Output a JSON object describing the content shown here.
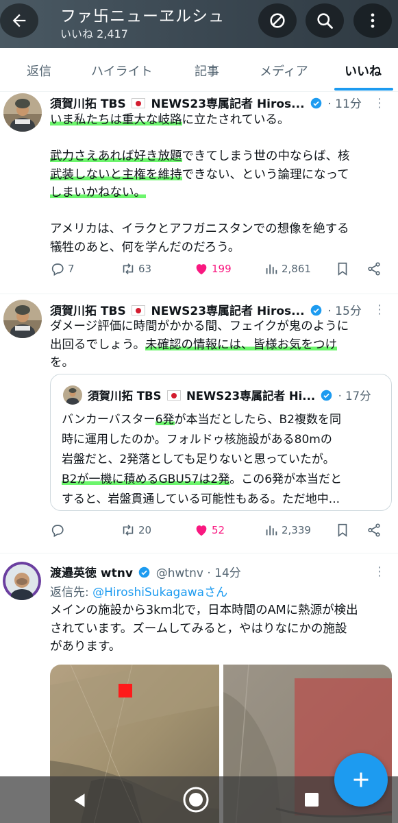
{
  "header": {
    "title": "ファ卐ニューヱルシュ",
    "likes": "いいね 2,417"
  },
  "tabs": [
    "返信",
    "ハイライト",
    "記事",
    "メディア",
    "いいね"
  ],
  "posts": [
    {
      "name": "須賀川拓 TBS",
      "name_suffix": "NEWS23専属記者 Hiros...",
      "time": "· 11分",
      "lines": [
        [
          "",
          "いま私たちは重大な岐路",
          "に立たされている。"
        ],
        [
          "",
          "",
          ""
        ],
        [
          "",
          "武力さえあれば好き放題",
          "できてしまう世の中ならば、核"
        ],
        [
          "",
          "武装しないと主権を維持",
          "できない、という論理になって"
        ],
        [
          "",
          "しまいかねない。",
          ""
        ],
        [
          "",
          "",
          ""
        ],
        [
          "アメリカは、イラクとアフガニスタンでの想像を絶する",
          "",
          ""
        ],
        [
          "犠牲のあと、何を学んだのだろう。",
          "",
          ""
        ]
      ],
      "reply": "7",
      "repost": "63",
      "like": "199",
      "views": "2,861"
    },
    {
      "name": "須賀川拓 TBS",
      "name_suffix": "NEWS23専属記者 Hiros...",
      "time": "· 15分",
      "lines": [
        [
          "ダメージ評価に時間がかかる間、フェイクが鬼のように",
          "",
          ""
        ],
        [
          "出回るでしょう。",
          "未確認の情報には、皆様お気をつけ",
          ""
        ],
        [
          "を。",
          "",
          ""
        ]
      ],
      "quote": {
        "name": "須賀川拓 TBS",
        "name_suffix": "NEWS23専属記者 Hi...",
        "time": "· 17分",
        "lines": [
          [
            "バンカーバスター",
            "6発",
            "が本当だとしたら、B2複数を同"
          ],
          [
            "時に運用したのか。フォルドゥ核施設がある80mの",
            "",
            ""
          ],
          [
            "岩盤だと、2発落としても足りないと思っていたが。",
            "",
            ""
          ],
          [
            "",
            "B2が一機に積めるGBU57は2発",
            "。この6発が本当だと"
          ],
          [
            "すると、岩盤貫通している可能性もある。ただ地中...",
            "",
            ""
          ]
        ]
      },
      "reply": "",
      "repost": "20",
      "like": "52",
      "views": "2,339"
    },
    {
      "name": "渡邉英徳 wtnv",
      "handle": "@hwtnv",
      "time": "· 14分",
      "reply_label": "返信先: ",
      "reply_target": "@HiroshiSukagawaさん",
      "lines": [
        [
          "メインの施設から3km北で，日本時間のAMに熱源が検出",
          "",
          ""
        ],
        [
          "されています。ズームしてみると，やはりなにかの施設",
          "",
          ""
        ],
        [
          "があります。",
          "",
          ""
        ]
      ]
    }
  ],
  "icons": {
    "back": "arrow-left-icon",
    "unfollow": "slash-circle-icon",
    "search": "search-icon",
    "more": "vertical-dots-icon"
  },
  "colors": {
    "accent": "#1d9bf0",
    "like": "#f91880",
    "highlight": "#6cf56c"
  }
}
